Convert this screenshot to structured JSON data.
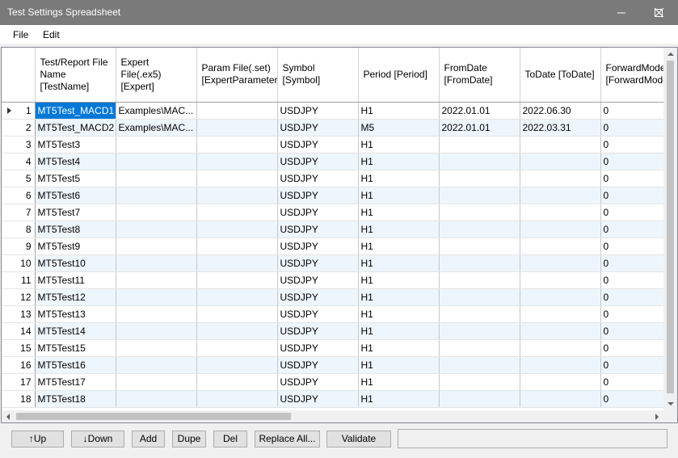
{
  "window": {
    "title": "Test Settings Spreadsheet"
  },
  "menu": [
    "File",
    "Edit"
  ],
  "grid": {
    "columns": [
      "Test/Report File Name [TestName]",
      "Expert File(.ex5) [Expert]",
      "Param File(.set) [ExpertParameter",
      "Symbol [Symbol]",
      "Period [Period]",
      "FromDate [FromDate]",
      "ToDate [ToDate]",
      "ForwardMode [ForwardMode"
    ],
    "rows": [
      {
        "num": "1",
        "cells": [
          "MT5Test_MACD1",
          "Examples\\MAC...",
          "",
          "USDJPY",
          "H1",
          "2022.01.01",
          "2022.06.30",
          "0"
        ]
      },
      {
        "num": "2",
        "cells": [
          "MT5Test_MACD2",
          "Examples\\MAC...",
          "",
          "USDJPY",
          "M5",
          "2022.01.01",
          "2022.03.31",
          "0"
        ]
      },
      {
        "num": "3",
        "cells": [
          "MT5Test3",
          "",
          "",
          "USDJPY",
          "H1",
          "",
          "",
          "0"
        ]
      },
      {
        "num": "4",
        "cells": [
          "MT5Test4",
          "",
          "",
          "USDJPY",
          "H1",
          "",
          "",
          "0"
        ]
      },
      {
        "num": "5",
        "cells": [
          "MT5Test5",
          "",
          "",
          "USDJPY",
          "H1",
          "",
          "",
          "0"
        ]
      },
      {
        "num": "6",
        "cells": [
          "MT5Test6",
          "",
          "",
          "USDJPY",
          "H1",
          "",
          "",
          "0"
        ]
      },
      {
        "num": "7",
        "cells": [
          "MT5Test7",
          "",
          "",
          "USDJPY",
          "H1",
          "",
          "",
          "0"
        ]
      },
      {
        "num": "8",
        "cells": [
          "MT5Test8",
          "",
          "",
          "USDJPY",
          "H1",
          "",
          "",
          "0"
        ]
      },
      {
        "num": "9",
        "cells": [
          "MT5Test9",
          "",
          "",
          "USDJPY",
          "H1",
          "",
          "",
          "0"
        ]
      },
      {
        "num": "10",
        "cells": [
          "MT5Test10",
          "",
          "",
          "USDJPY",
          "H1",
          "",
          "",
          "0"
        ]
      },
      {
        "num": "11",
        "cells": [
          "MT5Test11",
          "",
          "",
          "USDJPY",
          "H1",
          "",
          "",
          "0"
        ]
      },
      {
        "num": "12",
        "cells": [
          "MT5Test12",
          "",
          "",
          "USDJPY",
          "H1",
          "",
          "",
          "0"
        ]
      },
      {
        "num": "13",
        "cells": [
          "MT5Test13",
          "",
          "",
          "USDJPY",
          "H1",
          "",
          "",
          "0"
        ]
      },
      {
        "num": "14",
        "cells": [
          "MT5Test14",
          "",
          "",
          "USDJPY",
          "H1",
          "",
          "",
          "0"
        ]
      },
      {
        "num": "15",
        "cells": [
          "MT5Test15",
          "",
          "",
          "USDJPY",
          "H1",
          "",
          "",
          "0"
        ]
      },
      {
        "num": "16",
        "cells": [
          "MT5Test16",
          "",
          "",
          "USDJPY",
          "H1",
          "",
          "",
          "0"
        ]
      },
      {
        "num": "17",
        "cells": [
          "MT5Test17",
          "",
          "",
          "USDJPY",
          "H1",
          "",
          "",
          "0"
        ]
      },
      {
        "num": "18",
        "cells": [
          "MT5Test18",
          "",
          "",
          "USDJPY",
          "H1",
          "",
          "",
          "0"
        ]
      }
    ]
  },
  "buttons": {
    "up": "↑Up",
    "down": "↓Down",
    "add": "Add",
    "dupe": "Dupe",
    "del": "Del",
    "replace_all": "Replace All...",
    "validate": "Validate"
  },
  "colors": {
    "titlebar": "#7a7a7a",
    "selection": "#0078d7",
    "alt_row": "#eef6fd"
  }
}
